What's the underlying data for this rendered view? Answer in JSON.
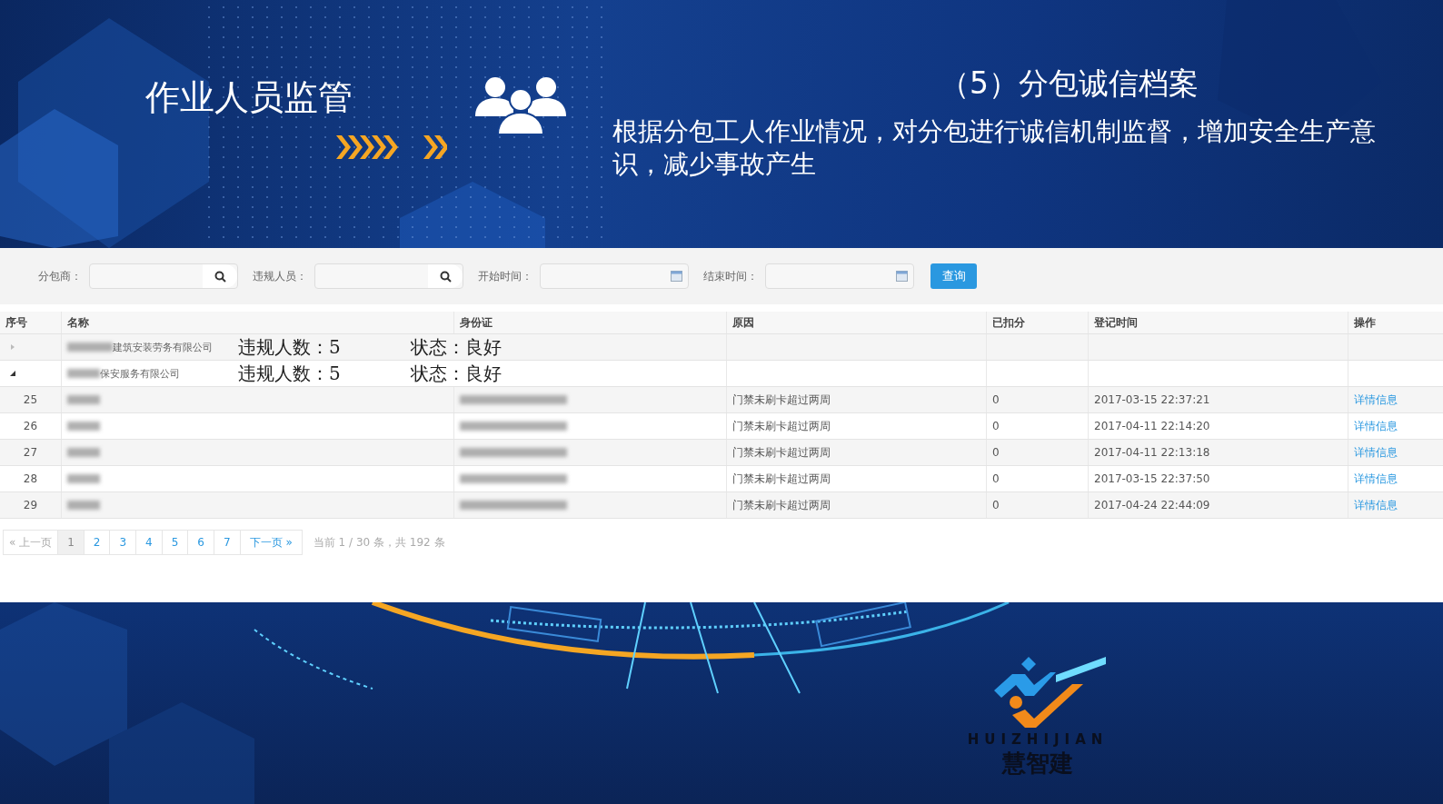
{
  "slide": {
    "title": "作业人员监管",
    "section_title": "（5）分包诚信档案",
    "description": "根据分包工人作业情况，对分包进行诚信机制监督，增加安全生产意识，减少事故产生"
  },
  "filters": [
    {
      "label": "分包商：",
      "kind": "search"
    },
    {
      "label": "违规人员：",
      "kind": "search"
    },
    {
      "label": "开始时间：",
      "kind": "date"
    },
    {
      "label": "结束时间：",
      "kind": "date"
    }
  ],
  "query_button": "查询",
  "table": {
    "columns": [
      "序号",
      "名称",
      "身份证",
      "原因",
      "已扣分",
      "登记时间",
      "操作"
    ],
    "groups": [
      {
        "expanded": false,
        "name": "建筑安装劳务有限公司",
        "count": "违规人数：5",
        "status": "状态：良好"
      },
      {
        "expanded": true,
        "name": "保安服务有限公司",
        "count": "违规人数：5",
        "status": "状态：良好",
        "rows": [
          {
            "index": "25",
            "reason": "门禁未刷卡超过两周",
            "deducted": "0",
            "time": "2017-03-15 22:37:21",
            "action": "详情信息"
          },
          {
            "index": "26",
            "reason": "门禁未刷卡超过两周",
            "deducted": "0",
            "time": "2017-04-11 22:14:20",
            "action": "详情信息"
          },
          {
            "index": "27",
            "reason": "门禁未刷卡超过两周",
            "deducted": "0",
            "time": "2017-04-11 22:13:18",
            "action": "详情信息"
          },
          {
            "index": "28",
            "reason": "门禁未刷卡超过两周",
            "deducted": "0",
            "time": "2017-03-15 22:37:50",
            "action": "详情信息"
          },
          {
            "index": "29",
            "reason": "门禁未刷卡超过两周",
            "deducted": "0",
            "time": "2017-04-24 22:44:09",
            "action": "详情信息"
          }
        ]
      }
    ]
  },
  "pagination": {
    "prev": "« 上一页",
    "pages": [
      {
        "label": "1",
        "selected": true
      },
      {
        "label": "2",
        "selected": false
      },
      {
        "label": "3",
        "selected": false
      },
      {
        "label": "4",
        "selected": false
      },
      {
        "label": "5",
        "selected": false
      },
      {
        "label": "6",
        "selected": false
      },
      {
        "label": "7",
        "selected": false
      }
    ],
    "next": "下一页 »",
    "summary": "当前 1 / 30 条，共 192 条"
  },
  "logo": {
    "latin": "HUIZHIJIAN",
    "name": "慧智建"
  }
}
